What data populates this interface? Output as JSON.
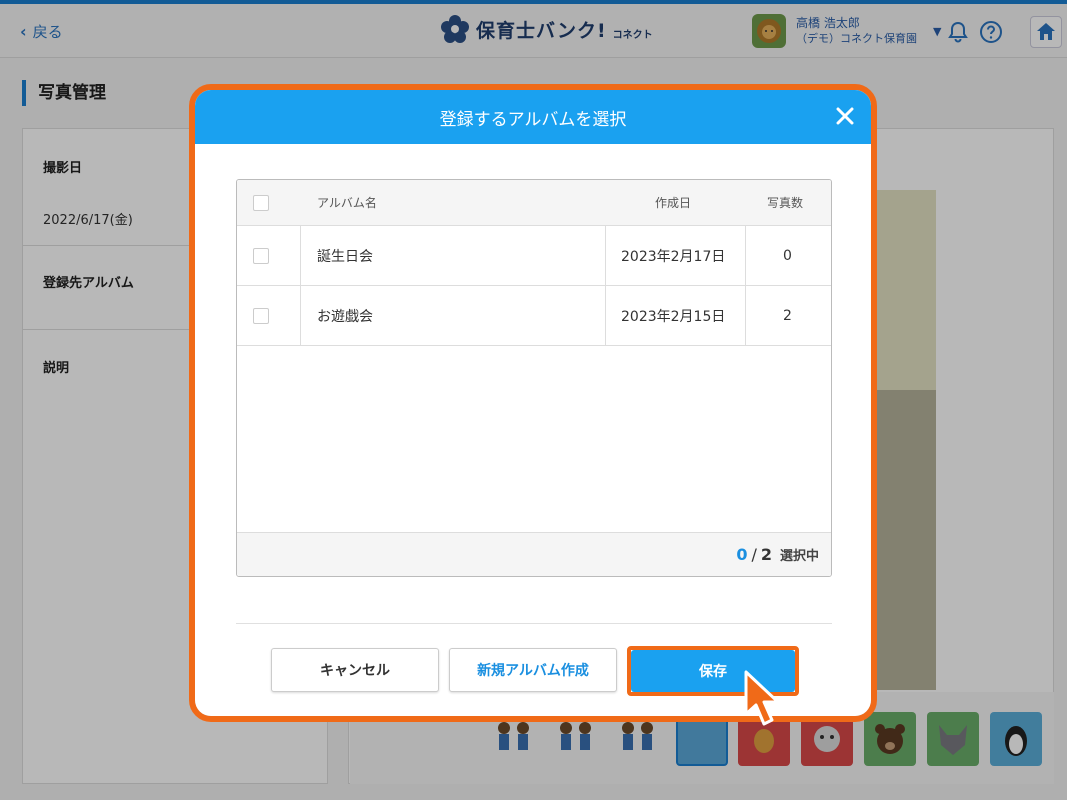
{
  "header": {
    "back_label": "戻る",
    "logo_text": "保育士バンク!",
    "logo_sub": "コネクト",
    "user_name": "高橋 浩太郎",
    "user_org": "（デモ）コネクト保育園"
  },
  "page": {
    "title": "写真管理",
    "fields": [
      {
        "label": "撮影日",
        "value": "2022/6/17(金)"
      },
      {
        "label": "登録先アルバム",
        "value": ""
      },
      {
        "label": "説明",
        "value": ""
      }
    ]
  },
  "modal": {
    "title": "登録するアルバムを選択",
    "columns": {
      "name": "アルバム名",
      "created": "作成日",
      "count": "写真数"
    },
    "rows": [
      {
        "name": "誕生日会",
        "created": "2023年2月17日",
        "count": "0",
        "checked": false
      },
      {
        "name": "お遊戯会",
        "created": "2023年2月15日",
        "count": "2",
        "checked": false
      }
    ],
    "selected_count": "0",
    "separator": "/",
    "total_count": "2",
    "selected_suffix": "選択中",
    "buttons": {
      "cancel": "キャンセル",
      "new_album": "新規アルバム作成",
      "save": "保存"
    }
  },
  "colors": {
    "accent": "#1aa1f0",
    "highlight": "#f06a18",
    "brand": "#1a7fd0"
  }
}
